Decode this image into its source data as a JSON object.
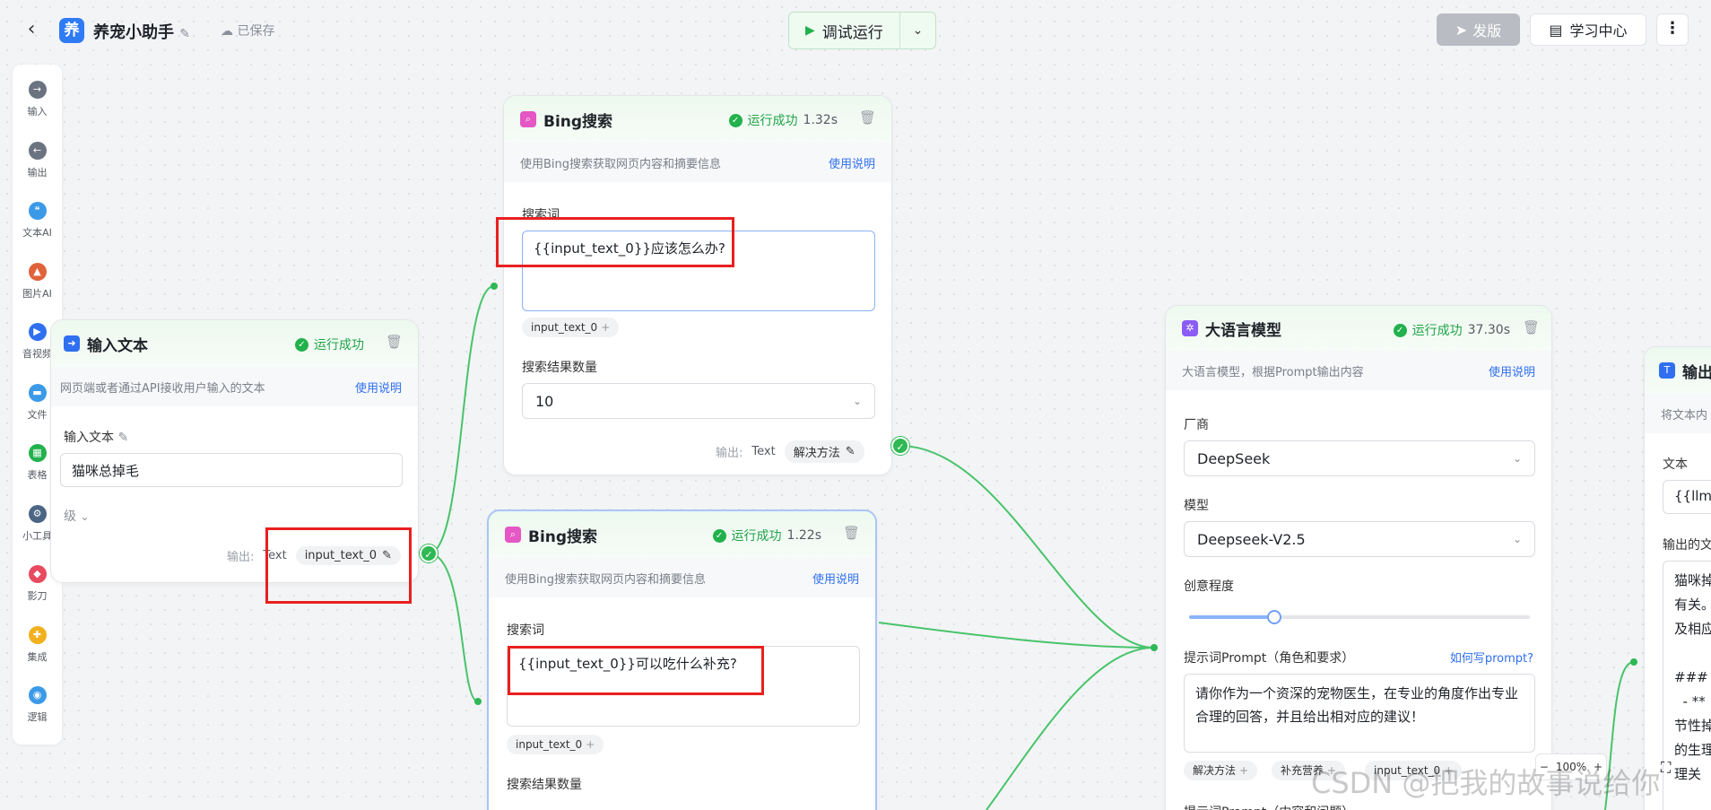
{
  "header": {
    "back_icon": "chevron-left-icon",
    "app_badge": "养",
    "app_name": "养宠小助手",
    "save_status": "已保存",
    "run_label": "调试运行",
    "publish_label": "发版",
    "learn_label": "学习中心"
  },
  "sidebar": {
    "items": [
      {
        "label": "输入",
        "icon": "arrow-right-icon",
        "color": "#6b7280"
      },
      {
        "label": "输出",
        "icon": "arrow-left-icon",
        "color": "#6b7280"
      },
      {
        "label": "文本AI",
        "icon": "quote-icon",
        "color": "#3b9ae8"
      },
      {
        "label": "图片AI",
        "icon": "image-icon",
        "color": "#e0623b"
      },
      {
        "label": "音视频",
        "icon": "video-icon",
        "color": "#2f6ff0"
      },
      {
        "label": "文件",
        "icon": "folder-icon",
        "color": "#3b9ae8"
      },
      {
        "label": "表格",
        "icon": "table-icon",
        "color": "#22b14c"
      },
      {
        "label": "小工具",
        "icon": "gear-icon",
        "color": "#4b6584"
      },
      {
        "label": "影刀",
        "icon": "blade-icon",
        "color": "#e84a5f"
      },
      {
        "label": "集成",
        "icon": "puzzle-icon",
        "color": "#f2b01e"
      },
      {
        "label": "逻辑",
        "icon": "logic-icon",
        "color": "#3b9ae8"
      }
    ]
  },
  "input_node": {
    "title": "输入文本",
    "status": "运行成功",
    "desc": "网页端或者通过API接收用户输入的文本",
    "help": "使用说明",
    "field_label": "输入文本",
    "field_value": "猫咪总掉毛",
    "advanced": "级",
    "out_label": "输出:",
    "out_type": "Text",
    "out_var": "input_text_0"
  },
  "bing1": {
    "title": "Bing搜索",
    "status": "运行成功",
    "time": "1.32s",
    "desc": "使用Bing搜索获取网页内容和摘要信息",
    "help": "使用说明",
    "query_label": "搜索词",
    "query_value": "{{input_text_0}}应该怎么办?",
    "tag": "input_text_0",
    "count_label": "搜索结果数量",
    "count_value": "10",
    "out_label": "输出:",
    "out_type": "Text",
    "out_var": "解决方法"
  },
  "bing2": {
    "title": "Bing搜索",
    "status": "运行成功",
    "time": "1.22s",
    "desc": "使用Bing搜索获取网页内容和摘要信息",
    "help": "使用说明",
    "query_label": "搜索词",
    "query_value": "{{input_text_0}}可以吃什么补充?",
    "tag": "input_text_0",
    "count_label": "搜索结果数量"
  },
  "llm": {
    "title": "大语言模型",
    "status": "运行成功",
    "time": "37.30s",
    "desc": "大语言模型，根据Prompt输出内容",
    "help": "使用说明",
    "vendor_label": "厂商",
    "vendor_value": "DeepSeek",
    "model_label": "模型",
    "model_value": "Deepseek-V2.5",
    "creativity_label": "创意程度",
    "creativity_level": 0.25,
    "prompt_label": "提示词Prompt（角色和要求）",
    "prompt_help": "如何写prompt?",
    "prompt_value": "请你作为一个资深的宠物医生，在专业的角度作出专业合理的回答，并且给出相对应的建议！",
    "tags": [
      "解决方法",
      "补充营养",
      "input_text_0"
    ],
    "prompt2_label": "提示词Prompt（内容和问题）"
  },
  "output_node": {
    "title": "输出",
    "desc": "将文本内",
    "text_label": "文本",
    "text_value": "{{llm_",
    "preview_label": "输出的文",
    "preview_lines": [
      "猫咪掉",
      "有关。",
      "及相应",
      "",
      "### 1",
      "  - **",
      "节性掉",
      "的生理",
      "理关"
    ]
  },
  "canvas": {
    "zoom": "100%"
  },
  "watermark": "CSDN @把我的故事说给你"
}
